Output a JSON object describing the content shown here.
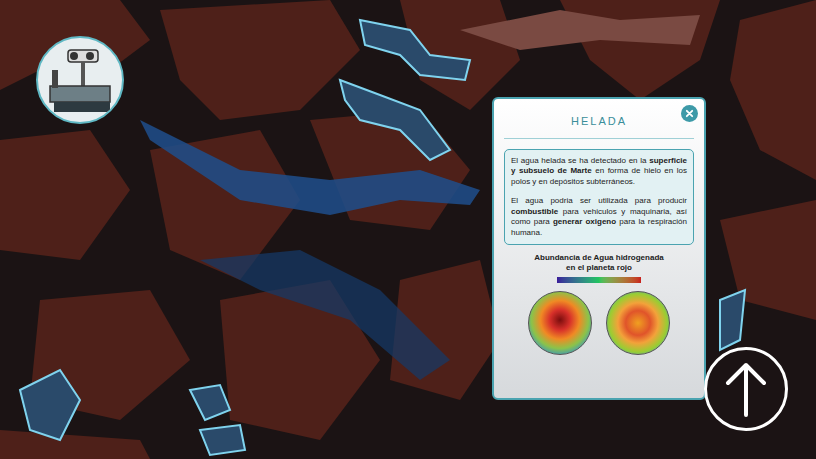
{
  "card": {
    "title": "HELADA",
    "paragraphs": [
      [
        {
          "text": "El agua helada se ha detectado en la ",
          "bold": false
        },
        {
          "text": "superficie y subsuelo de Marte",
          "bold": true
        },
        {
          "text": " en forma de hielo en los polos y en depósitos subterráneos.",
          "bold": false
        }
      ],
      [
        {
          "text": "El agua podria ser utilizada para producir ",
          "bold": false
        },
        {
          "text": "combustible",
          "bold": true
        },
        {
          "text": " para vehiculos y maquinaria, así como para ",
          "bold": false
        },
        {
          "text": "generar oxigeno",
          "bold": true
        },
        {
          "text": " para la respiración humana.",
          "bold": false
        }
      ]
    ],
    "chart": {
      "title_lines": [
        "Abundancia de Agua hidrogenada",
        "en el planeta rojo"
      ]
    }
  }
}
